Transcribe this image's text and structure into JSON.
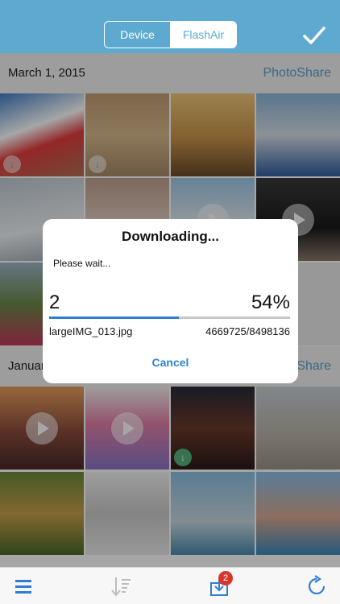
{
  "header": {
    "segments": [
      "Device",
      "FlashAir"
    ],
    "selected": "FlashAir",
    "confirm_icon": "checkmark-icon"
  },
  "sections": [
    {
      "date": "March 1, 2015",
      "link": "PhotoShare"
    },
    {
      "date": "January",
      "link": "PhotoShare"
    }
  ],
  "dialog": {
    "title": "Downloading...",
    "message": "Please wait...",
    "count": "2",
    "percent": "54%",
    "progress_fraction": 0.54,
    "filename": "largeIMG_013.jpg",
    "bytes": "4669725/8498136",
    "cancel_label": "Cancel"
  },
  "toolbar": {
    "icons": [
      "menu-icon",
      "sort-icon",
      "download-inbox-icon",
      "refresh-icon"
    ],
    "badge_count": "2"
  },
  "colors": {
    "accent": "#5da9cf",
    "link": "#5aa2cf",
    "progress": "#2f7ed1",
    "badge": "#d9362b"
  }
}
